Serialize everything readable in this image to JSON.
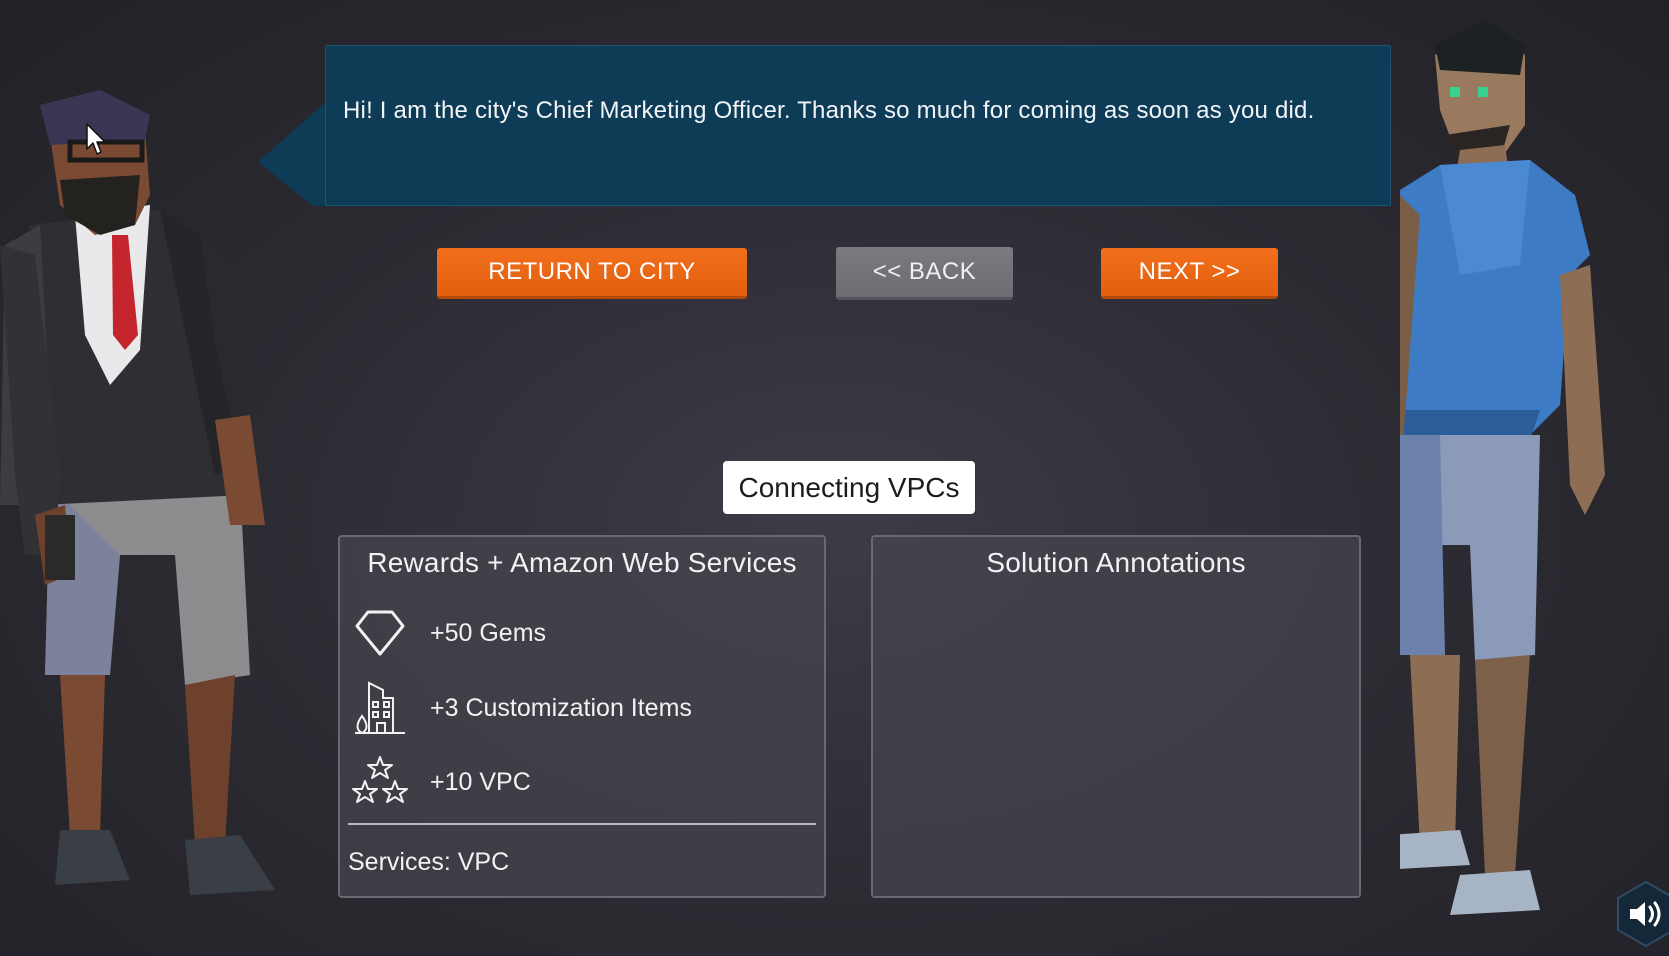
{
  "dialogue": {
    "speaker": "Chief Marketing Officer",
    "text": "Hi! I am the city's Chief Marketing Officer. Thanks so much for coming as soon as you did."
  },
  "buttons": {
    "return_label": "RETURN TO CITY",
    "back_label": "<< BACK",
    "next_label": "NEXT >>"
  },
  "level": {
    "title": "Connecting VPCs"
  },
  "rewards_panel": {
    "title": "Rewards + Amazon Web Services",
    "items": [
      {
        "icon": "diamond-gem-icon",
        "label": "+50 Gems"
      },
      {
        "icon": "building-icon",
        "label": "+3 Customization Items"
      },
      {
        "icon": "stars-icon",
        "label": "+10 VPC"
      }
    ],
    "services": "Services: VPC"
  },
  "annotations_panel": {
    "title": "Solution Annotations"
  },
  "colors": {
    "background": "#2b2a31",
    "bubble": "#0e3b56",
    "accent_orange": "#f06a18",
    "button_gray": "#747479",
    "panel": "#46444e"
  },
  "icons": {
    "sound": "speaker-volume-icon",
    "cursor": "mouse-pointer-icon"
  }
}
